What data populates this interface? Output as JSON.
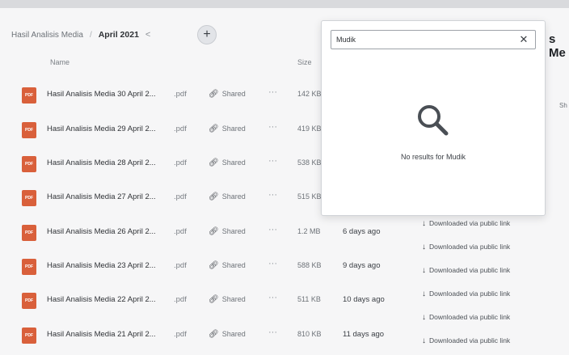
{
  "breadcrumb": {
    "parent": "Hasil Analisis Media",
    "current": "April 2021"
  },
  "columns": {
    "name": "Name",
    "size": "Size"
  },
  "right_panel": {
    "title": "s Me",
    "sub": "Sh"
  },
  "search": {
    "value": "Mudik",
    "empty_text": "No results for Mudik"
  },
  "files": [
    {
      "name": "Hasil Analisis Media 30 April 2...",
      "ext": ".pdf",
      "sharing": "Shared",
      "size": "142 KB",
      "modified": "",
      "activity": ""
    },
    {
      "name": "Hasil Analisis Media 29 April 2...",
      "ext": ".pdf",
      "sharing": "Shared",
      "size": "419 KB",
      "modified": "",
      "activity": ""
    },
    {
      "name": "Hasil Analisis Media 28 April 2...",
      "ext": ".pdf",
      "sharing": "Shared",
      "size": "538 KB",
      "modified": "",
      "activity": ""
    },
    {
      "name": "Hasil Analisis Media 27 April 2...",
      "ext": ".pdf",
      "sharing": "Shared",
      "size": "515 KB",
      "modified": "",
      "activity": ""
    },
    {
      "name": "Hasil Analisis Media 26 April 2...",
      "ext": ".pdf",
      "sharing": "Shared",
      "size": "1.2 MB",
      "modified": "6 days ago",
      "activity": "Downloaded via public link"
    },
    {
      "name": "Hasil Analisis Media 23 April 2...",
      "ext": ".pdf",
      "sharing": "Shared",
      "size": "588 KB",
      "modified": "9 days ago",
      "activity": "Downloaded via public link"
    },
    {
      "name": "Hasil Analisis Media 22 April 2...",
      "ext": ".pdf",
      "sharing": "Shared",
      "size": "511 KB",
      "modified": "10 days ago",
      "activity": "Downloaded via public link"
    },
    {
      "name": "Hasil Analisis Media 21 April 2...",
      "ext": ".pdf",
      "sharing": "Shared",
      "size": "810 KB",
      "modified": "11 days ago",
      "activity": "Downloaded via public link"
    }
  ],
  "extra_activity": [
    "Downloaded via public link",
    "Downloaded via public link",
    "Downloaded via public link",
    "Downloaded via public link"
  ]
}
